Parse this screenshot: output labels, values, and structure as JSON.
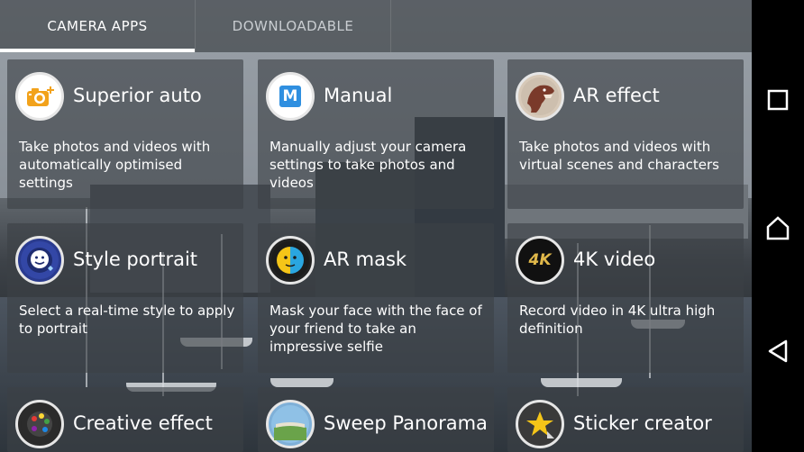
{
  "tabs": [
    {
      "label": "CAMERA APPS",
      "active": true
    },
    {
      "label": "DOWNLOADABLE",
      "active": false
    }
  ],
  "apps": [
    {
      "title": "Superior auto",
      "desc": "Take photos and videos with automatically optimised settings",
      "icon": "camera-plus-icon"
    },
    {
      "title": "Manual",
      "desc": "Manually adjust your camera settings to take photos and videos",
      "icon": "manual-m-icon"
    },
    {
      "title": "AR effect",
      "desc": "Take photos and videos with virtual scenes and characters",
      "icon": "dinosaur-icon"
    },
    {
      "title": "Style portrait",
      "desc": "Select a real-time style to apply to portrait",
      "icon": "portrait-face-icon"
    },
    {
      "title": "AR mask",
      "desc": "Mask your face with the face of your friend to take an impressive selfie",
      "icon": "mask-face-icon"
    },
    {
      "title": "4K video",
      "desc": "Record video in 4K ultra high definition",
      "icon": "4k-icon",
      "icon_text": "4K"
    },
    {
      "title": "Creative effect",
      "desc": "",
      "icon": "palette-icon"
    },
    {
      "title": "Sweep Panorama",
      "desc": "",
      "icon": "panorama-icon"
    },
    {
      "title": "Sticker creator",
      "desc": "",
      "icon": "star-sticker-icon"
    }
  ],
  "manual_icon_letter": "M",
  "nav": {
    "recents": "recents-square-icon",
    "home": "home-icon",
    "back": "back-triangle-icon"
  },
  "colors": {
    "accent": "#ffffff",
    "tab_inactive": "#c9cdd1",
    "manual_blue": "#2f8fe0",
    "superior_orange": "#f2a21b"
  }
}
